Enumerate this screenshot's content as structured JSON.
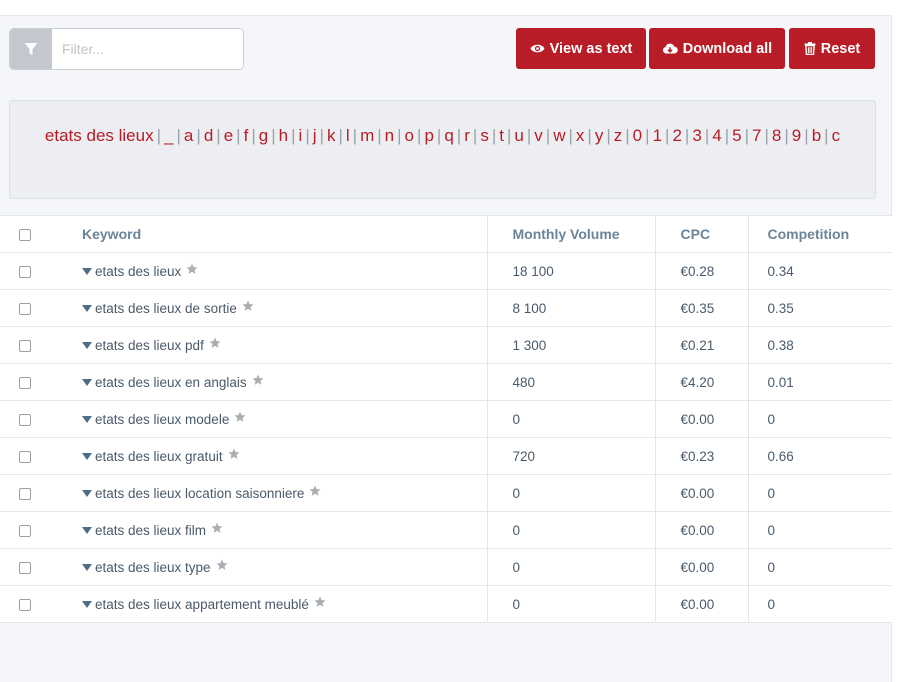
{
  "filter": {
    "placeholder": "Filter..."
  },
  "toolbar": {
    "view_label": "View as text",
    "download_label": "Download all",
    "reset_label": "Reset"
  },
  "alphabet": {
    "links": [
      "etats des lieux",
      "_",
      "a",
      "d",
      "e",
      "f",
      "g",
      "h",
      "i",
      "j",
      "k",
      "l",
      "m",
      "n",
      "o",
      "p",
      "q",
      "r",
      "s",
      "t",
      "u",
      "v",
      "w",
      "x",
      "y",
      "z",
      "0",
      "1",
      "2",
      "3",
      "4",
      "5",
      "7",
      "8",
      "9",
      "b",
      "c"
    ]
  },
  "table": {
    "headers": {
      "keyword": "Keyword",
      "volume": "Monthly Volume",
      "cpc": "CPC",
      "competition": "Competition"
    },
    "rows": [
      {
        "keyword": "etats des lieux",
        "volume": "18 100",
        "cpc": "€0.28",
        "competition": "0.34"
      },
      {
        "keyword": "etats des lieux de sortie",
        "volume": "8 100",
        "cpc": "€0.35",
        "competition": "0.35"
      },
      {
        "keyword": "etats des lieux pdf",
        "volume": "1 300",
        "cpc": "€0.21",
        "competition": "0.38"
      },
      {
        "keyword": "etats des lieux en anglais",
        "volume": "480",
        "cpc": "€4.20",
        "competition": "0.01"
      },
      {
        "keyword": "etats des lieux modele",
        "volume": "0",
        "cpc": "€0.00",
        "competition": "0"
      },
      {
        "keyword": "etats des lieux gratuit",
        "volume": "720",
        "cpc": "€0.23",
        "competition": "0.66"
      },
      {
        "keyword": "etats des lieux location saisonniere",
        "volume": "0",
        "cpc": "€0.00",
        "competition": "0"
      },
      {
        "keyword": "etats des lieux film",
        "volume": "0",
        "cpc": "€0.00",
        "competition": "0"
      },
      {
        "keyword": "etats des lieux type",
        "volume": "0",
        "cpc": "€0.00",
        "competition": "0"
      },
      {
        "keyword": "etats des lieux appartement meublé",
        "volume": "0",
        "cpc": "€0.00",
        "competition": "0"
      }
    ]
  },
  "colors": {
    "accent": "#b81c26",
    "header_text": "#6b8498",
    "star": "#a9aeb3"
  },
  "icons": {
    "filter": "filter-icon",
    "view": "eye-icon",
    "download": "cloud-download-icon",
    "reset": "trash-icon",
    "expand": "caret-down-icon",
    "favorite": "star-icon"
  }
}
